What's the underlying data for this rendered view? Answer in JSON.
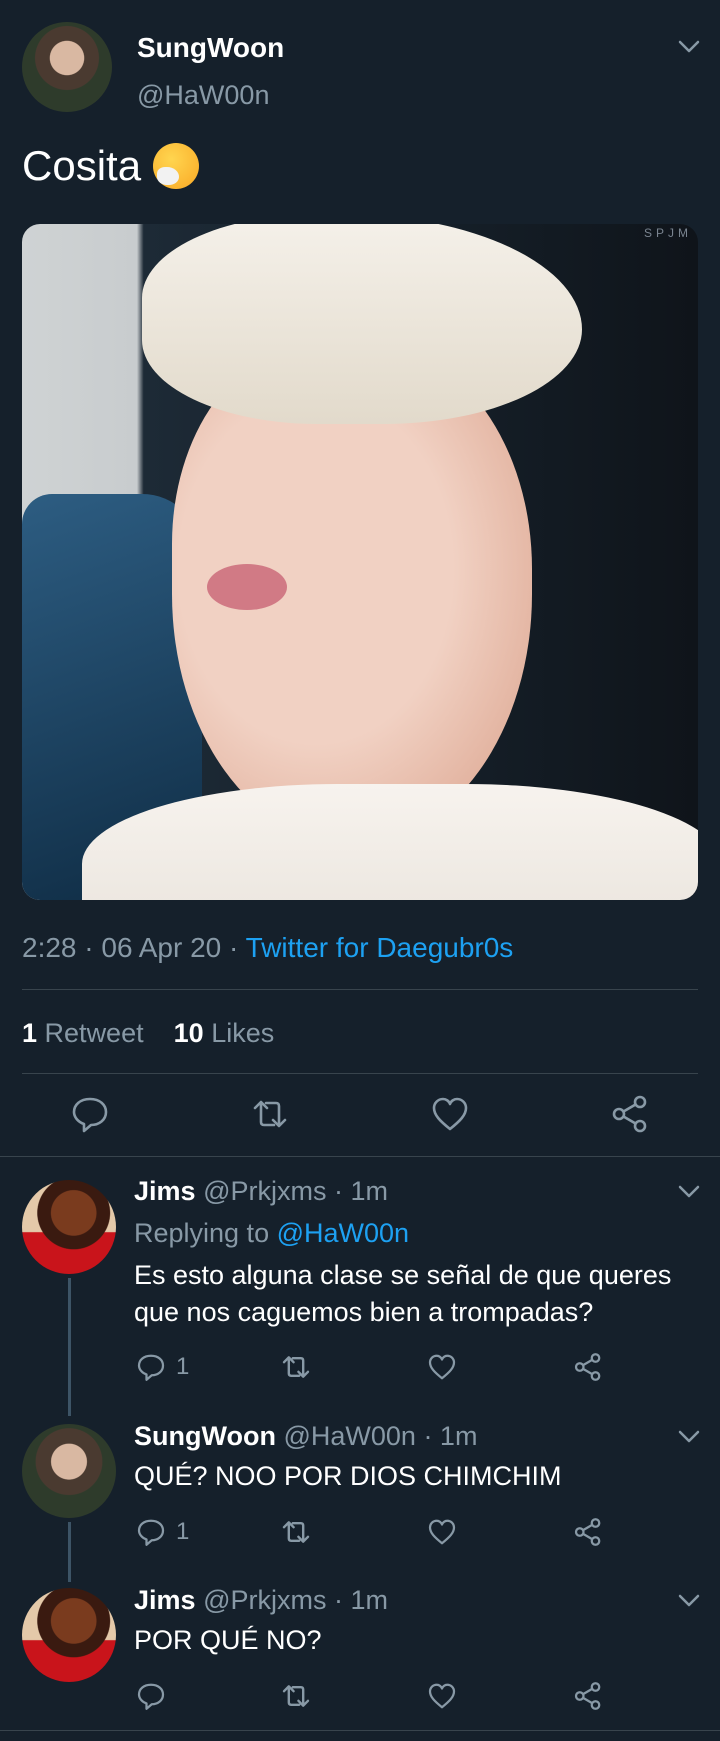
{
  "tweet": {
    "author_name": "SungWoon",
    "author_handle": "@HaW00n",
    "text": "Cosita",
    "emoji_icon": "sneezing-face",
    "photo_watermark": "SPJM",
    "time": "2:28 · 06 Apr 20 · ",
    "source": "Twitter for Daegubr0s",
    "retweet_count": "1",
    "retweet_label": "Retweet",
    "like_count": "10",
    "like_label": "Likes"
  },
  "replies": [
    {
      "name": "Jims",
      "handle": "@Prkjxms · 1m",
      "replying_prefix": "Replying to ",
      "replying_to": "@HaW00n",
      "text": "Es esto alguna clase se señal de que queres que nos caguemos bien a trompadas?",
      "reply_count": "1"
    },
    {
      "name": "SungWoon",
      "handle": "@HaW00n · 1m",
      "text": "QUÉ? NOO POR DIOS CHIMCHIM",
      "reply_count": "1"
    },
    {
      "name": "Jims",
      "handle": "@Prkjxms · 1m",
      "text": "POR QUÉ NO?",
      "reply_count": ""
    }
  ],
  "colors": {
    "background": "#15202b",
    "muted": "#8899a6",
    "link": "#1da1f2",
    "divider": "#38444d"
  }
}
